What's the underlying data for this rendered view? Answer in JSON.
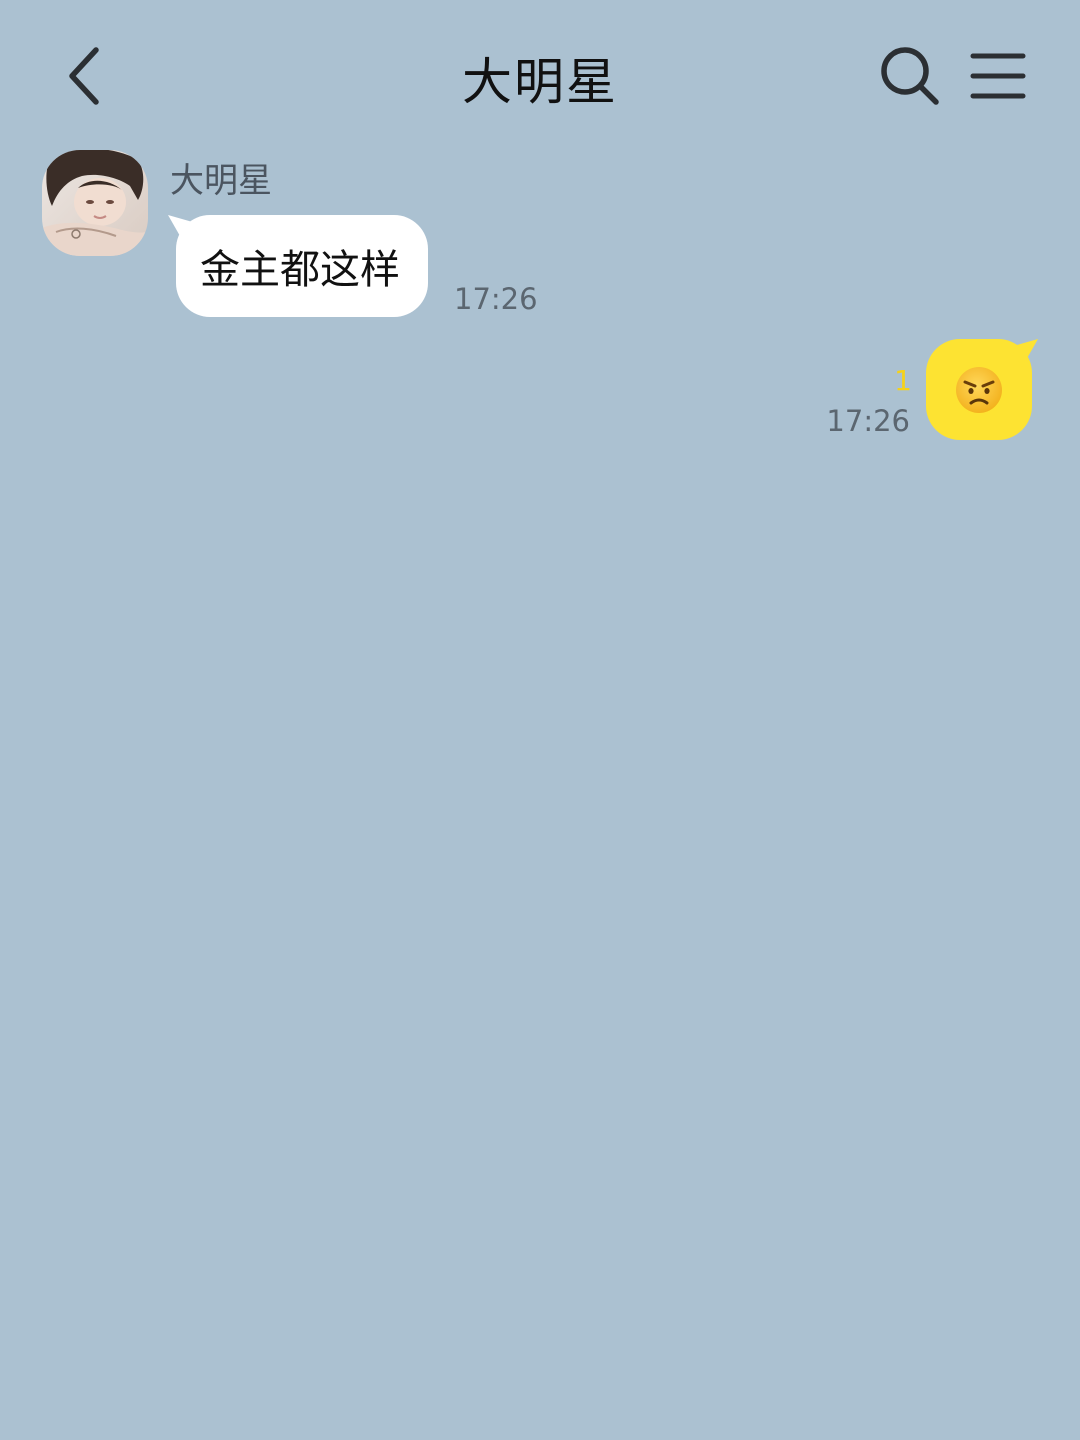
{
  "header": {
    "back_icon": "chevron-left-icon",
    "title": "大明星",
    "search_icon": "search-icon",
    "menu_icon": "hamburger-menu-icon"
  },
  "messages": [
    {
      "direction": "incoming",
      "sender": "大明星",
      "avatar": "contact-avatar-photo",
      "text": "金主都这样",
      "time": "17:26"
    },
    {
      "direction": "outgoing",
      "emoji": "angry-face-emoji",
      "unread_count": "1",
      "time": "17:26"
    }
  ],
  "colors": {
    "background": "#abc1d1",
    "incoming_bubble": "#ffffff",
    "outgoing_bubble": "#fde332",
    "unread_count": "#f5d21a"
  }
}
